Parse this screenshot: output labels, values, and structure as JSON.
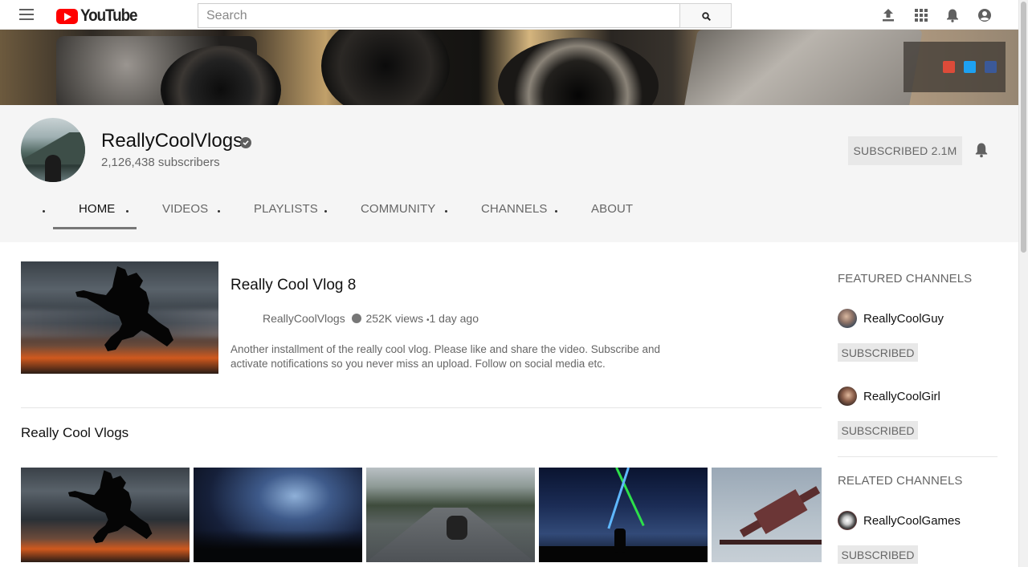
{
  "topbar": {
    "logo_text": "YouTube",
    "search_placeholder": "Search"
  },
  "channel": {
    "name": "ReallyCoolVlogs",
    "subscribers": "2,126,438 subscribers",
    "subscribe_label": "SUBSCRIBED 2.1M"
  },
  "tabs": [
    {
      "label": "HOME",
      "active": true
    },
    {
      "label": "VIDEOS",
      "active": false
    },
    {
      "label": "PLAYLISTS",
      "active": false
    },
    {
      "label": "COMMUNITY",
      "active": false
    },
    {
      "label": "CHANNELS",
      "active": false
    },
    {
      "label": "ABOUT",
      "active": false
    }
  ],
  "featured_video": {
    "title": "Really Cool Vlog 8",
    "channel": "ReallyCoolVlogs",
    "views": "252K views",
    "age": "1 day ago",
    "description": "Another installment of the really cool vlog. Please like and share the video. Subscribe and activate notifications so you never miss an upload. Follow on social media etc."
  },
  "section": {
    "title": "Really Cool Vlogs"
  },
  "sidebar": {
    "featured_heading": "FEATURED CHANNELS",
    "related_heading": "RELATED CHANNELS",
    "featured": [
      {
        "name": "ReallyCoolGuy",
        "button": "SUBSCRIBED"
      },
      {
        "name": "ReallyCoolGirl",
        "button": "SUBSCRIBED"
      }
    ],
    "related": [
      {
        "name": "ReallyCoolGames",
        "button": "SUBSCRIBED"
      }
    ]
  },
  "social_icons": [
    "google-plus-icon",
    "twitter-icon",
    "facebook-icon"
  ],
  "colors": {
    "brand_red": "#ff0000",
    "twitter": "#1da1f2",
    "facebook": "#3b5998",
    "google_plus": "#dd4b39"
  }
}
